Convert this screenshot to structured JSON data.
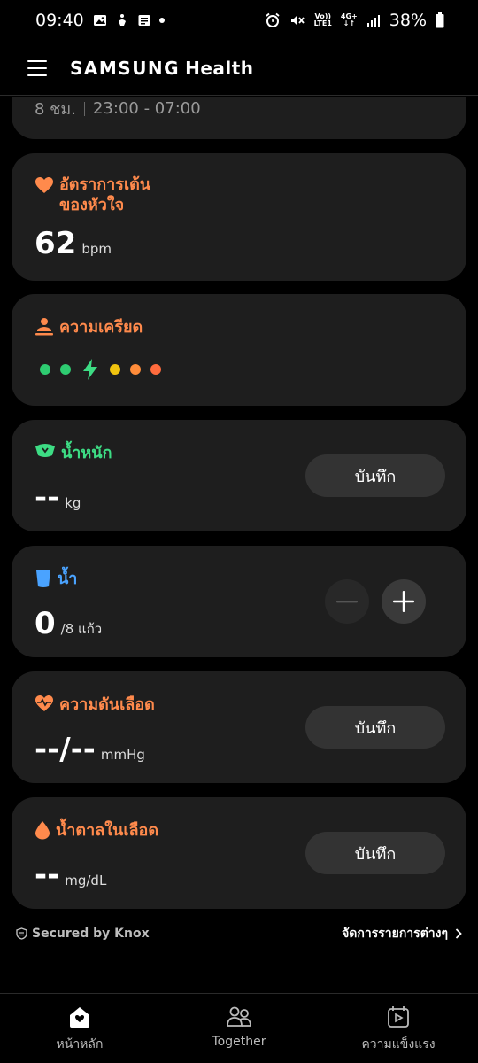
{
  "status": {
    "time": "09:40",
    "battery": "38%",
    "volte": "Vo))",
    "lte": "LTE1",
    "net": "4G+"
  },
  "header": {
    "brand_main": "SAMSUNG",
    "brand_sub": "Health"
  },
  "sleep": {
    "duration": "8 ชม.",
    "range": "23:00 - 07:00"
  },
  "heart": {
    "title_line1": "อัตราการเต้น",
    "title_line2": "ของหัวใจ",
    "value": "62",
    "unit": "bpm",
    "color": "#ff8a4c"
  },
  "stress": {
    "title": "ความเครียด",
    "color": "#ff8a4c",
    "levels": [
      "#2ecc71",
      "#2ecc71",
      "#f1c40f",
      "#ff8c3a",
      "#ff6b3d"
    ]
  },
  "weight": {
    "title": "น้ำหนัก",
    "value": "--",
    "unit": "kg",
    "button": "บันทึก",
    "color": "#3ddc84"
  },
  "water": {
    "title": "น้ำ",
    "value": "0",
    "unit": "/8 แก้ว",
    "color": "#4aa3ff"
  },
  "bp": {
    "title": "ความดันเลือด",
    "value": "--/--",
    "unit": "mmHg",
    "button": "บันทึก",
    "color": "#ff8a4c"
  },
  "glucose": {
    "title": "น้ำตาลในเลือด",
    "value": "--",
    "unit": "mg/dL",
    "button": "บันทึก",
    "color": "#ff8a4c"
  },
  "footer": {
    "knox": "Secured by Knox",
    "manage": "จัดการรายการต่างๆ"
  },
  "nav": [
    {
      "label": "หน้าหลัก",
      "icon": "home-icon"
    },
    {
      "label": "Together",
      "icon": "people-icon"
    },
    {
      "label": "ความแข็งแรง",
      "icon": "fitness-video-icon"
    }
  ]
}
